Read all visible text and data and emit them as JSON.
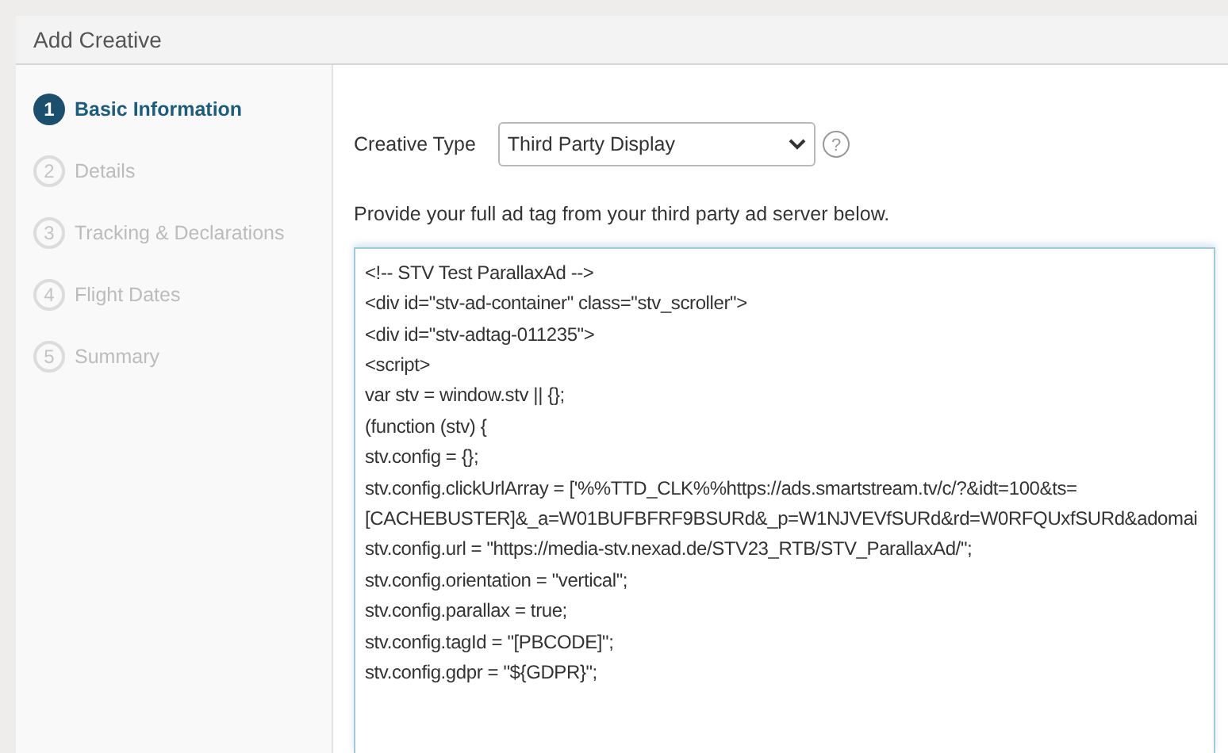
{
  "window": {
    "title": "Add Creative"
  },
  "steps": [
    {
      "number": "1",
      "label": "Basic Information",
      "selected": true
    },
    {
      "number": "2",
      "label": "Details",
      "selected": false
    },
    {
      "number": "3",
      "label": "Tracking & Declarations",
      "selected": false
    },
    {
      "number": "4",
      "label": "Flight Dates",
      "selected": false
    },
    {
      "number": "5",
      "label": "Summary",
      "selected": false
    }
  ],
  "creative_type": {
    "label": "Creative Type",
    "value": "Third Party Display",
    "help": "?"
  },
  "instructions": "Provide your full ad tag from your third party ad server below.",
  "ad_tag_lines": [
    "<!-- STV Test ParallaxAd -->",
    "<div id=\"stv-ad-container\" class=\"stv_scroller\">",
    "<div id=\"stv-adtag-011235\">",
    "<script>",
    "var stv = window.stv || {};",
    "(function (stv) {",
    "stv.config = {};",
    "stv.config.clickUrlArray = ['%%TTD_CLK%%https://ads.smartstream.tv/c/?&idt=100&ts=",
    "[CACHEBUSTER]&_a=W01BUFBFRF9BSURd&_p=W1NJVEVfSURd&rd=W0RFQUxfSURd&adomai",
    "stv.config.url = \"https://media-stv.nexad.de/STV23_RTB/STV_ParallaxAd/\";",
    "stv.config.orientation = \"vertical\";",
    "stv.config.parallax = true;",
    "stv.config.tagId = \"[PBCODE]\";",
    "stv.config.gdpr = \"${GDPR}\";"
  ]
}
